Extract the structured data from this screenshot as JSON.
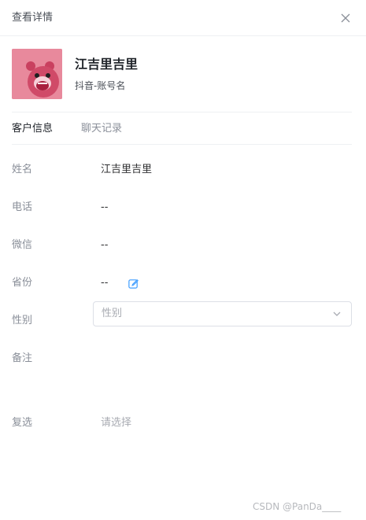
{
  "header": {
    "title": "查看详情",
    "close_icon": "close-icon"
  },
  "profile": {
    "avatar_icon": "bear-avatar",
    "name": "江吉里吉里",
    "account": "抖音-账号名"
  },
  "tabs": [
    {
      "label": "客户信息",
      "active": true
    },
    {
      "label": "聊天记录",
      "active": false
    }
  ],
  "fields": {
    "name": {
      "label": "姓名",
      "value": "江吉里吉里"
    },
    "phone": {
      "label": "电话",
      "value": "--"
    },
    "wechat": {
      "label": "微信",
      "value": "--"
    },
    "province": {
      "label": "省份",
      "value": "--",
      "icon": "edit-icon"
    },
    "gender": {
      "label": "性别",
      "placeholder": "性别",
      "icon": "chevron-down-icon"
    },
    "remark": {
      "label": "备注",
      "value": ""
    },
    "multi": {
      "label": "复选",
      "placeholder": "请选择"
    }
  },
  "watermark": "CSDN @PanDa____",
  "colors": {
    "accent": "#409eff",
    "avatar_bg": "#e8899c",
    "muted": "#8a8f99"
  }
}
